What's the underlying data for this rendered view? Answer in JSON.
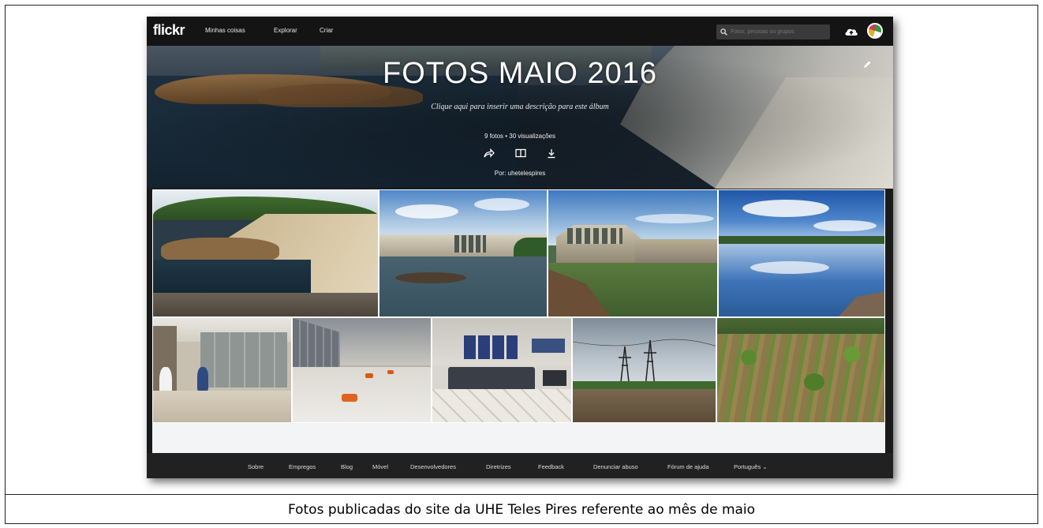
{
  "flickr": {
    "logo": "flickr",
    "nav": {
      "my_stuff": "Minhas coisas",
      "explore": "Explorar",
      "create": "Criar"
    },
    "search": {
      "placeholder": "Fotos, pessoas ou grupos"
    },
    "icons": {
      "search": "search-icon",
      "upload": "upload-icon",
      "avatar": "avatar"
    }
  },
  "album": {
    "title": "FOTOS MAIO 2016",
    "description": "Clique aqui para inserir uma descrição para este álbum",
    "stats": "9 fotos  •  30 visualizações",
    "by": "Por: uhetelespires",
    "actions": [
      "share-icon",
      "slideshow-icon",
      "download-icon"
    ]
  },
  "photos": [
    {
      "row": 1,
      "subject": "dam spillway with rocks and reservoir"
    },
    {
      "row": 1,
      "subject": "dam gates over river with sky"
    },
    {
      "row": 1,
      "subject": "dam intake structure with green water"
    },
    {
      "row": 1,
      "subject": "reservoir reflecting clouds"
    },
    {
      "row": 2,
      "subject": "control panels with workers"
    },
    {
      "row": 2,
      "subject": "generator hall with orange machinery"
    },
    {
      "row": 2,
      "subject": "control room with monitors"
    },
    {
      "row": 2,
      "subject": "transmission towers over cliff"
    },
    {
      "row": 2,
      "subject": "revegetated field with young trees"
    }
  ],
  "footer": {
    "links": [
      "Sobre",
      "Empregos",
      "Blog",
      "Móvel",
      "Desenvolvedores",
      "Diretrizes",
      "Feedback",
      "Denunciar abuso",
      "Fórum de ajuda",
      "Português ⌄"
    ]
  },
  "caption": "Fotos publicadas do site da UHE Teles Pires referente ao mês de maio",
  "colors": {
    "nav_bg": "#141414",
    "footer_bg": "#212121",
    "accent_white": "#ffffff"
  }
}
